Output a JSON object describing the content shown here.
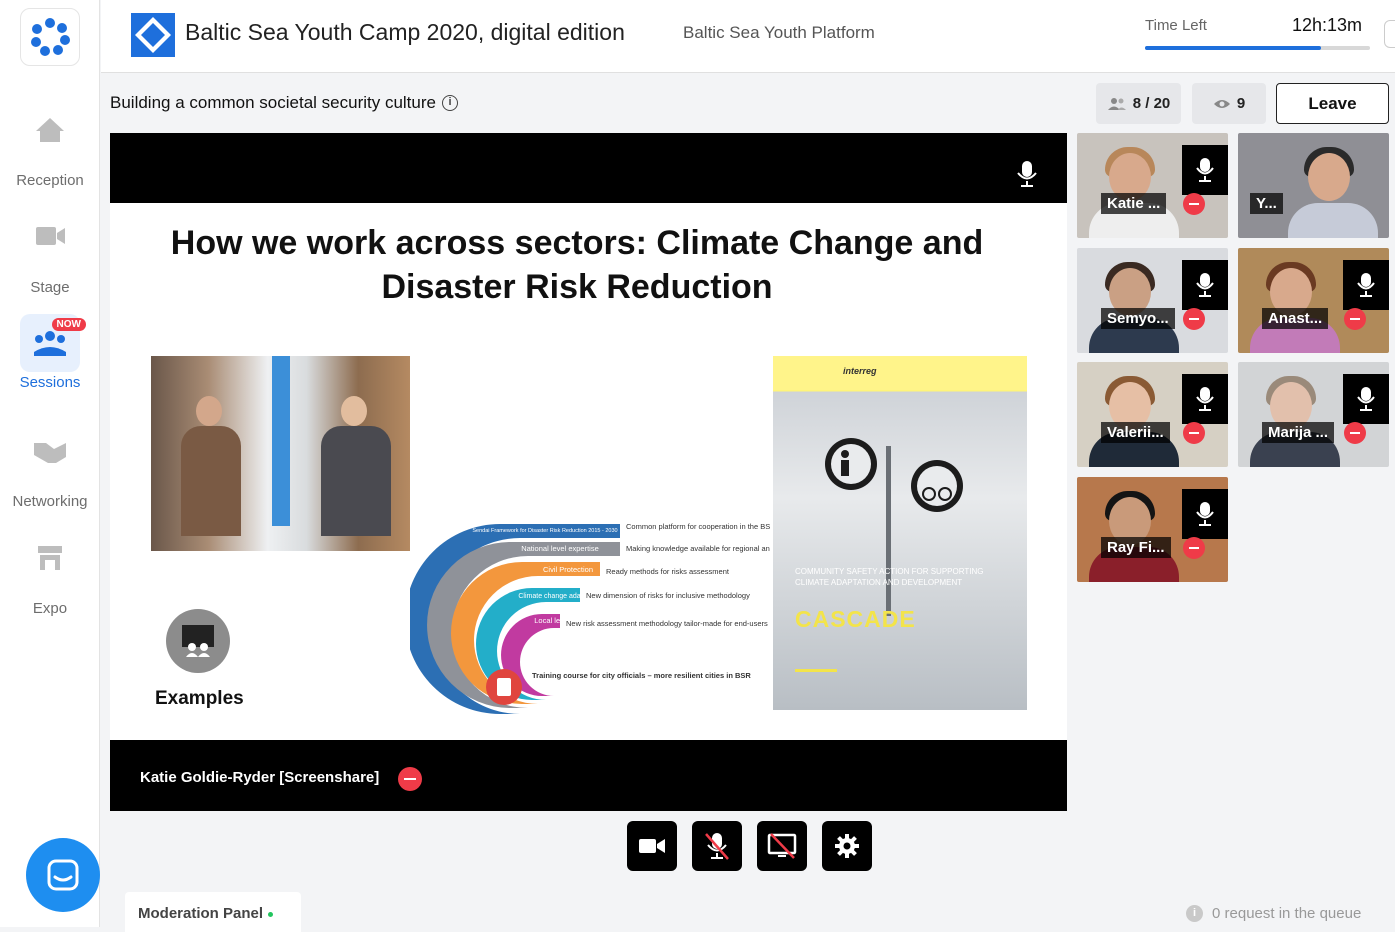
{
  "app": {
    "title": "Baltic Sea Youth Camp 2020, digital edition",
    "organizer": "Baltic Sea Youth Platform"
  },
  "timer": {
    "label": "Time Left",
    "value": "12h:13m",
    "progress_fraction": 0.78
  },
  "sidebar": {
    "items": [
      {
        "label": "Reception",
        "icon": "home-icon"
      },
      {
        "label": "Stage",
        "icon": "video-camera-icon"
      },
      {
        "label": "Sessions",
        "icon": "people-group-icon",
        "badge": "NOW",
        "active": true
      },
      {
        "label": "Networking",
        "icon": "handshake-icon"
      },
      {
        "label": "Expo",
        "icon": "booth-icon"
      }
    ]
  },
  "session": {
    "title": "Building a common societal security culture",
    "attendees": "8 / 20",
    "viewers": "9",
    "leave_label": "Leave"
  },
  "stage": {
    "slide_title": "How we work across sectors: Climate Change and Disaster Risk Reduction",
    "examples_label": "Examples",
    "infographic": {
      "band_labels": [
        "Sendai Framework for Disaster Risk Reduction 2015 - 2030",
        "National level expertise",
        "Civil Protection",
        "Climate change adaptation",
        "Local level"
      ],
      "descriptions": [
        "Common platform for cooperation in the BSR",
        "Making knowledge available for regional and local levels",
        "Ready methods for risks assessment",
        "New dimension of risks for inclusive methodology",
        "New risk assessment methodology tailor-made for end-users",
        "Training course for city officials – more resilient cities in BSR"
      ]
    },
    "poster": {
      "headline": "CASCADE",
      "subtitle": "COMMUNITY SAFETY ACTION FOR SUPPORTING CLIMATE ADAPTATION AND DEVELOPMENT",
      "brand": "interreg"
    },
    "presenter": "Katie Goldie-Ryder [Screenshare]"
  },
  "controls": [
    "video-camera-icon",
    "microphone-muted-icon",
    "screen-share-off-icon",
    "gear-icon"
  ],
  "participants": [
    {
      "name": "Katie ...",
      "has_mic": true,
      "removable": true
    },
    {
      "name": "Y...",
      "has_mic": false,
      "removable": false
    },
    {
      "name": "Semyo...",
      "has_mic": true,
      "removable": true
    },
    {
      "name": "Anast...",
      "has_mic": true,
      "removable": true
    },
    {
      "name": "Valerii...",
      "has_mic": true,
      "removable": true
    },
    {
      "name": "Marija ...",
      "has_mic": true,
      "removable": true
    },
    {
      "name": "Ray Fi...",
      "has_mic": true,
      "removable": true
    }
  ],
  "footer": {
    "moderation_label": "Moderation Panel",
    "queue_text": "0 request in the queue"
  },
  "colors": {
    "accent": "#1e6fdc",
    "danger": "#ef3b48",
    "stage_bg": "#000000"
  }
}
